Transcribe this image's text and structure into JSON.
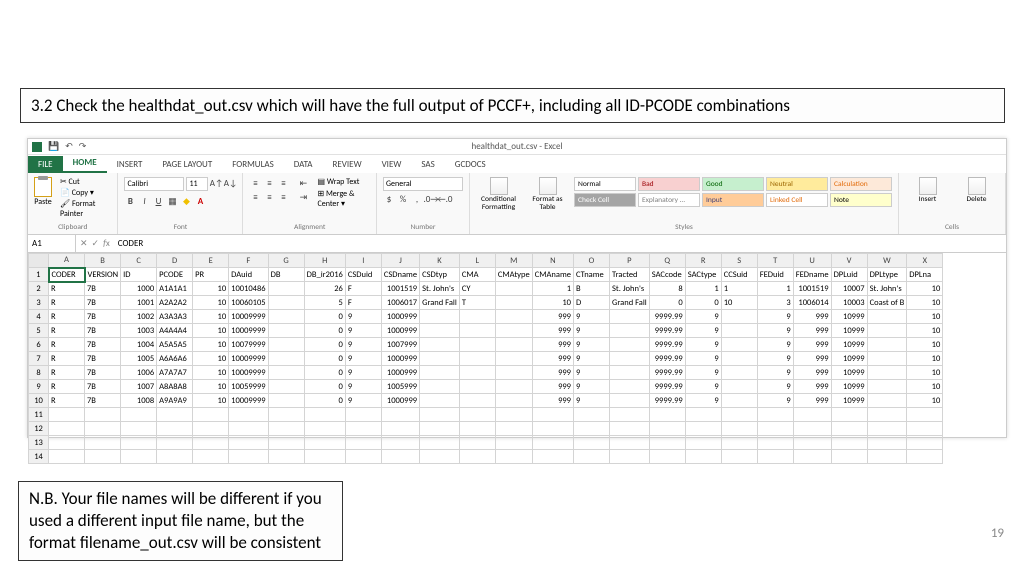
{
  "textbox_top": "3.2 Check the healthdat_out.csv which will have the full output of PCCF+, including all ID-PCODE combinations",
  "textbox_bottom": "N.B. Your file names will be different if you used a different input file name, but the format filename_out.csv will be consistent",
  "page_number": "19",
  "excel": {
    "title": "healthdat_out.csv - Excel",
    "tabs": [
      "FILE",
      "HOME",
      "INSERT",
      "PAGE LAYOUT",
      "FORMULAS",
      "DATA",
      "REVIEW",
      "VIEW",
      "SAS",
      "GCDOCS"
    ],
    "clipboard": {
      "paste": "Paste",
      "cut": "Cut",
      "copy": "Copy",
      "painter": "Format Painter",
      "label": "Clipboard"
    },
    "font": {
      "name": "Calibri",
      "size": "11",
      "label": "Font"
    },
    "alignment": {
      "wrap": "Wrap Text",
      "merge": "Merge & Center",
      "label": "Alignment"
    },
    "number": {
      "format": "General",
      "label": "Number"
    },
    "cond": {
      "cf": "Conditional Formatting",
      "ft": "Format as Table"
    },
    "styles": {
      "label": "Styles",
      "cells": [
        {
          "t": "Normal",
          "bg": "#fff",
          "c": "#000"
        },
        {
          "t": "Bad",
          "bg": "#f8d0d0",
          "c": "#9c0006"
        },
        {
          "t": "Good",
          "bg": "#c6efce",
          "c": "#006100"
        },
        {
          "t": "Neutral",
          "bg": "#ffeb9c",
          "c": "#9c6500"
        },
        {
          "t": "Calculation",
          "bg": "#fde9d9",
          "c": "#e26b0a"
        },
        {
          "t": "Check Cell",
          "bg": "#a5a5a5",
          "c": "#fff"
        },
        {
          "t": "Explanatory …",
          "bg": "#fff",
          "c": "#7f7f7f"
        },
        {
          "t": "Input",
          "bg": "#ffcc99",
          "c": "#3f3f76"
        },
        {
          "t": "Linked Cell",
          "bg": "#fff",
          "c": "#e26b0a"
        },
        {
          "t": "Note",
          "bg": "#ffffcc",
          "c": "#000"
        }
      ]
    },
    "cells_group": {
      "insert": "Insert",
      "delete": "Delete",
      "label": "Cells"
    },
    "namebox": "A1",
    "formula": "CODER",
    "columns": [
      "A",
      "B",
      "C",
      "D",
      "E",
      "F",
      "G",
      "H",
      "I",
      "J",
      "K",
      "L",
      "M",
      "N",
      "O",
      "P",
      "Q",
      "R",
      "S",
      "T",
      "U",
      "V",
      "W",
      "X"
    ],
    "headers": [
      "CODER",
      "VERSION",
      "ID",
      "PCODE",
      "PR",
      "DAuid",
      "DB",
      "DB_ir2016",
      "CSDuid",
      "CSDname",
      "CSDtyp",
      "CMA",
      "CMAtype",
      "CMAname",
      "CTname",
      "Tracted",
      "SACcode",
      "SACtype",
      "CCSuid",
      "FEDuid",
      "FEDname",
      "DPLuid",
      "DPLtype",
      "DPLna"
    ],
    "rows": [
      [
        "R",
        "7B",
        "1000",
        "A1A1A1",
        "10",
        "10010486",
        "",
        "26",
        "F",
        "1001519",
        "St. John's",
        "CY",
        "",
        "1",
        "B",
        "St. John's",
        "8",
        "1",
        "1",
        "1",
        "1001519",
        "10007",
        "St. John's",
        "10"
      ],
      [
        "R",
        "7B",
        "1001",
        "A2A2A2",
        "10",
        "10060105",
        "",
        "5",
        "F",
        "1006017",
        "Grand Fall",
        "T",
        "",
        "10",
        "D",
        "Grand Fall",
        "0",
        "0",
        "10",
        "3",
        "1006014",
        "10003",
        "Coast of B",
        "10"
      ],
      [
        "R",
        "7B",
        "1002",
        "A3A3A3",
        "10",
        "10009999",
        "",
        "0",
        "9",
        "1000999",
        "",
        "",
        "",
        "999",
        "9",
        "",
        "9999.99",
        "9",
        "",
        "9",
        "999",
        "10999",
        "",
        "10"
      ],
      [
        "R",
        "7B",
        "1003",
        "A4A4A4",
        "10",
        "10009999",
        "",
        "0",
        "9",
        "1000999",
        "",
        "",
        "",
        "999",
        "9",
        "",
        "9999.99",
        "9",
        "",
        "9",
        "999",
        "10999",
        "",
        "10"
      ],
      [
        "R",
        "7B",
        "1004",
        "A5A5A5",
        "10",
        "10079999",
        "",
        "0",
        "9",
        "1007999",
        "",
        "",
        "",
        "999",
        "9",
        "",
        "9999.99",
        "9",
        "",
        "9",
        "999",
        "10999",
        "",
        "10"
      ],
      [
        "R",
        "7B",
        "1005",
        "A6A6A6",
        "10",
        "10009999",
        "",
        "0",
        "9",
        "1000999",
        "",
        "",
        "",
        "999",
        "9",
        "",
        "9999.99",
        "9",
        "",
        "9",
        "999",
        "10999",
        "",
        "10"
      ],
      [
        "R",
        "7B",
        "1006",
        "A7A7A7",
        "10",
        "10009999",
        "",
        "0",
        "9",
        "1000999",
        "",
        "",
        "",
        "999",
        "9",
        "",
        "9999.99",
        "9",
        "",
        "9",
        "999",
        "10999",
        "",
        "10"
      ],
      [
        "R",
        "7B",
        "1007",
        "A8A8A8",
        "10",
        "10059999",
        "",
        "0",
        "9",
        "1005999",
        "",
        "",
        "",
        "999",
        "9",
        "",
        "9999.99",
        "9",
        "",
        "9",
        "999",
        "10999",
        "",
        "10"
      ],
      [
        "R",
        "7B",
        "1008",
        "A9A9A9",
        "10",
        "10009999",
        "",
        "0",
        "9",
        "1000999",
        "",
        "",
        "",
        "999",
        "9",
        "",
        "9999.99",
        "9",
        "",
        "9",
        "999",
        "10999",
        "",
        "10"
      ]
    ],
    "numeric_cols": [
      2,
      4,
      5,
      7,
      9,
      13,
      16,
      17,
      19,
      20,
      21,
      23
    ],
    "empty_rows": 4
  }
}
